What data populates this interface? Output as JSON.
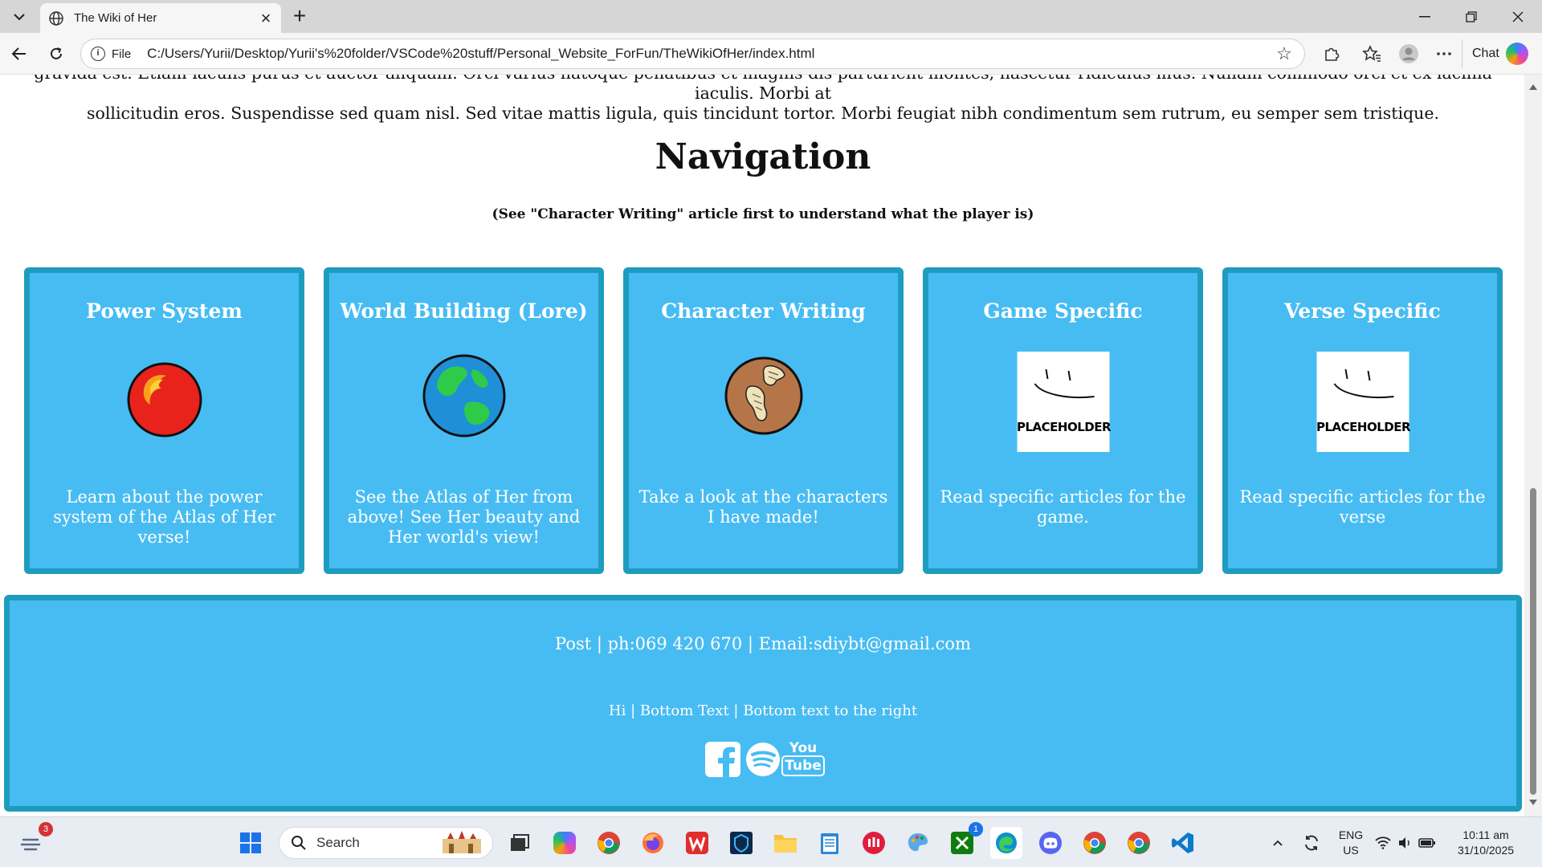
{
  "browser": {
    "tab_title": "The Wiki of Her",
    "scheme_label": "File",
    "url": "C:/Users/Yurii/Desktop/Yurii's%20folder/VSCode%20stuff/Personal_Website_ForFun/TheWikiOfHer/index.html",
    "chat_label": "Chat"
  },
  "page": {
    "intro_line1": "gravida est. Etiam iaculis purus et auctor aliquam. Orci varius natoque penatibus et magnis dis parturient montes, nascetur ridiculus mus. Nullam commodo orci et ex lacinia iaculis. Morbi at",
    "intro_line2": "sollicitudin eros. Suspendisse sed quam nisl. Sed vitae mattis ligula, quis tincidunt tortor. Morbi feugiat nibh condimentum sem rutrum, eu semper sem tristique.",
    "nav_heading": "Navigation",
    "nav_subtitle": "(See \"Character Writing\" article first to understand what the player is)",
    "cards": [
      {
        "title": "Power System",
        "description": "Learn about the power system of the Atlas of Her verse!",
        "icon": "fire-orb-icon"
      },
      {
        "title": "World Building (Lore)",
        "description": "See the Atlas of Her from above! See Her beauty and Her world's view!",
        "icon": "planet-earth-icon"
      },
      {
        "title": "Character Writing",
        "description": "Take a look at the characters I have made!",
        "icon": "scroll-planet-icon"
      },
      {
        "title": "Game Specific",
        "description": "Read specific articles for the game.",
        "icon": "placeholder-image",
        "placeholder_text": "PLACEHOLDER"
      },
      {
        "title": "Verse Specific",
        "description": "Read specific articles for the verse",
        "icon": "placeholder-image",
        "placeholder_text": "PLACEHOLDER"
      }
    ],
    "footer": {
      "contact": "Post | ph:069 420 670 | Email:sdiybt@gmail.com",
      "bottom_text": "Hi | Bottom Text | Bottom text to the right",
      "socials": [
        "facebook-icon",
        "spotify-icon",
        "youtube-icon"
      ],
      "youtube_label_top": "You",
      "youtube_label_bottom": "Tube"
    }
  },
  "taskbar": {
    "search_placeholder": "Search",
    "notification_count": "3",
    "xbox_badge": "1",
    "language_line1": "ENG",
    "language_line2": "US",
    "time": "10:11 am",
    "date": "31/10/2025"
  },
  "colors": {
    "card_bg": "#47bcf2",
    "card_border": "#1e9cbf",
    "text_on_card": "#ffffff"
  }
}
